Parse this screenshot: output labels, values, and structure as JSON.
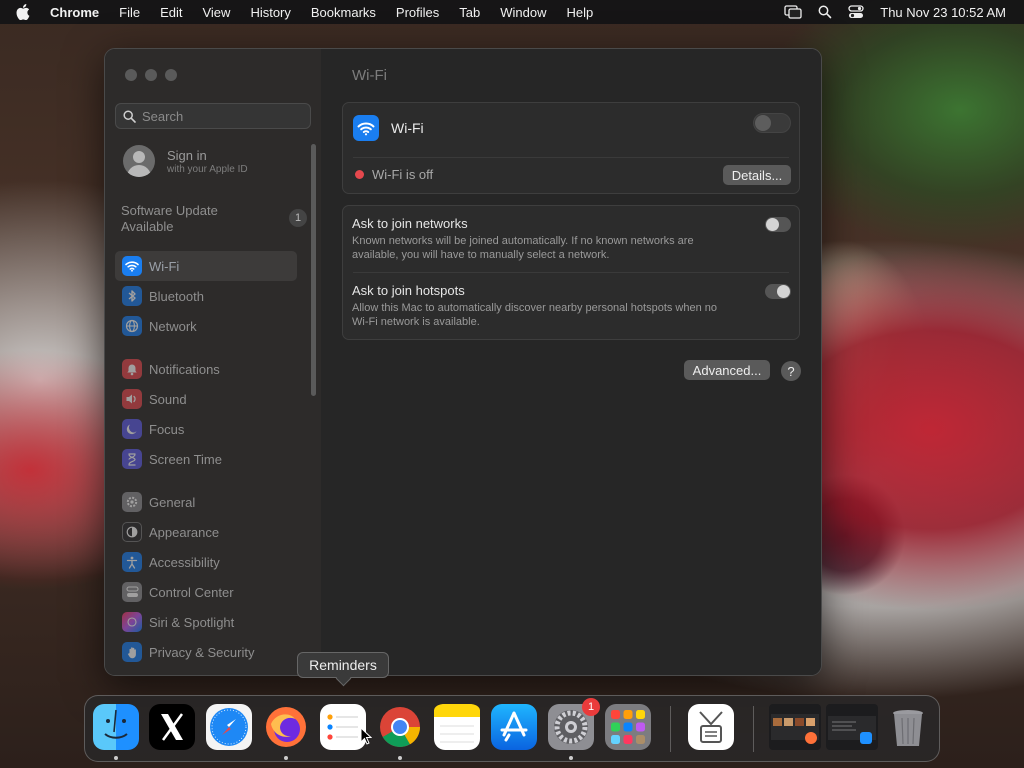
{
  "menubar": {
    "app_name": "Chrome",
    "items": [
      "File",
      "Edit",
      "View",
      "History",
      "Bookmarks",
      "Profiles",
      "Tab",
      "Window",
      "Help"
    ],
    "clock": "Thu Nov 23  10:52 AM"
  },
  "sidebar": {
    "search_placeholder": "Search",
    "signin": {
      "title": "Sign in",
      "subtitle": "with your Apple ID"
    },
    "software_update": {
      "line1": "Software Update",
      "line2": "Available",
      "badge": "1"
    },
    "items": [
      {
        "label": "Wi-Fi",
        "icon": "wifi-icon",
        "color": "#1a7ef0",
        "selected": true
      },
      {
        "label": "Bluetooth",
        "icon": "bluetooth-icon",
        "color": "#1a7ef0"
      },
      {
        "label": "Network",
        "icon": "globe-icon",
        "color": "#1a7ef0"
      },
      {
        "label": "Notifications",
        "icon": "bell-icon",
        "color": "#e5484d"
      },
      {
        "label": "Sound",
        "icon": "speaker-icon",
        "color": "#e5484d"
      },
      {
        "label": "Focus",
        "icon": "moon-icon",
        "color": "#5e5ce6"
      },
      {
        "label": "Screen Time",
        "icon": "hourglass-icon",
        "color": "#5e5ce6"
      },
      {
        "label": "General",
        "icon": "gear-icon",
        "color": "#8e8e93"
      },
      {
        "label": "Appearance",
        "icon": "appearance-icon",
        "color": "#2c2c2e"
      },
      {
        "label": "Accessibility",
        "icon": "accessibility-icon",
        "color": "#1a7ef0"
      },
      {
        "label": "Control Center",
        "icon": "control-center-icon",
        "color": "#8e8e93"
      },
      {
        "label": "Siri & Spotlight",
        "icon": "siri-icon",
        "color": "#bf5af2"
      },
      {
        "label": "Privacy & Security",
        "icon": "hand-icon",
        "color": "#1a7ef0"
      }
    ]
  },
  "main": {
    "title": "Wi-Fi",
    "wifi_label": "Wi-Fi",
    "wifi_enabled": false,
    "status_text": "Wi-Fi is off",
    "details_button": "Details...",
    "ask_networks": {
      "title": "Ask to join networks",
      "line1": "Known networks will be joined automatically. If no known networks are",
      "line2": "available, you will have to manually select a network.",
      "enabled": false
    },
    "ask_hotspots": {
      "title": "Ask to join hotspots",
      "line1": "Allow this Mac to automatically discover nearby personal hotspots when no",
      "line2": "Wi-Fi network is available.",
      "enabled": true
    },
    "advanced_button": "Advanced...",
    "help_button": "?"
  },
  "tooltip": "Reminders",
  "dock": {
    "apps": [
      "Finder",
      "X",
      "Safari",
      "Firefox",
      "Reminders",
      "Chrome",
      "Notes",
      "App Store",
      "System Settings",
      "Launchpad",
      "Archive Utility",
      "Recent Window 1",
      "Recent Window 2",
      "Trash"
    ],
    "system_settings_badge": "1"
  },
  "colors": {
    "accent": "#1a7ef0",
    "status_off": "#e5484d",
    "badge": "#ea3b3b"
  }
}
